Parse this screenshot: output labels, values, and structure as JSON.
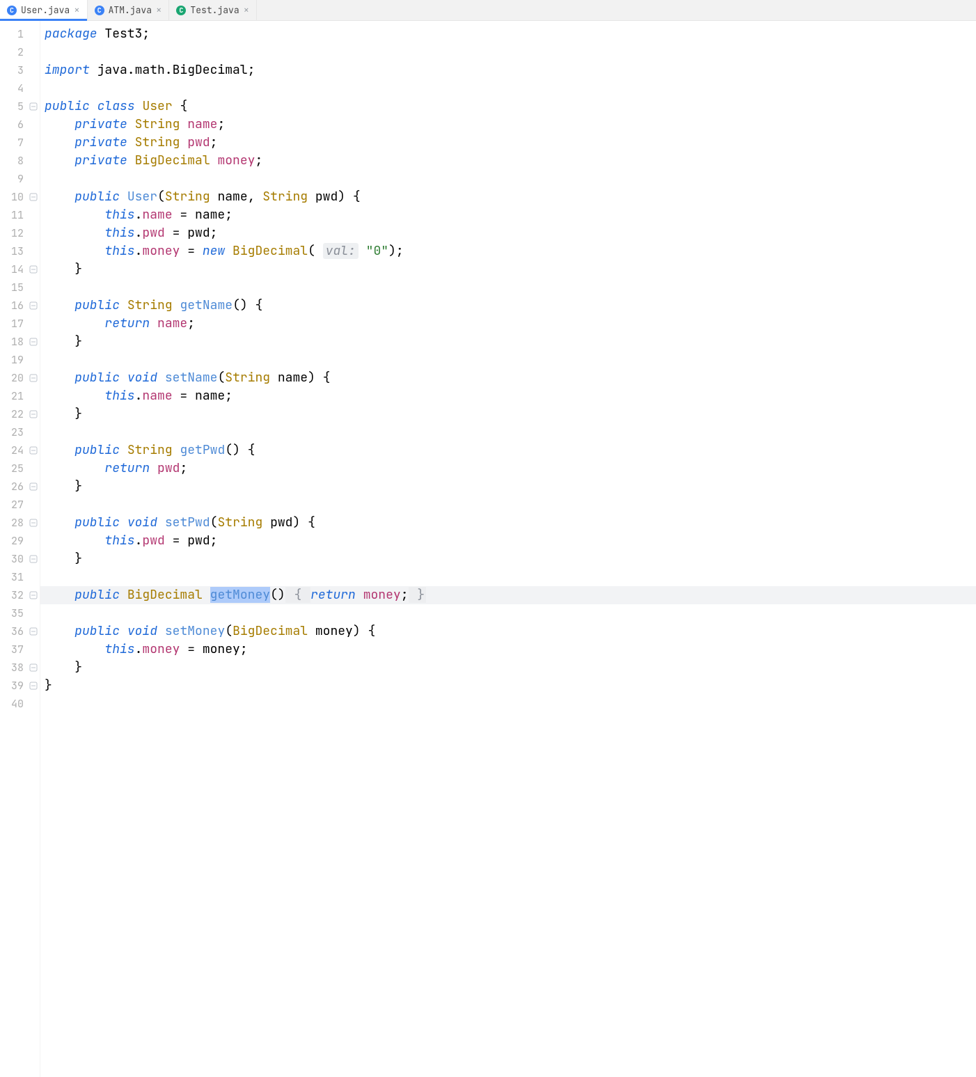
{
  "tabs": [
    {
      "label": "User.java",
      "iconLetter": "C",
      "iconClass": "c",
      "active": true
    },
    {
      "label": "ATM.java",
      "iconLetter": "C",
      "iconClass": "c",
      "active": false
    },
    {
      "label": "Test.java",
      "iconLetter": "C",
      "iconClass": "ct",
      "active": false
    }
  ],
  "lineNumbers": [
    "1",
    "2",
    "3",
    "4",
    "5",
    "6",
    "7",
    "8",
    "9",
    "10",
    "11",
    "12",
    "13",
    "14",
    "15",
    "16",
    "17",
    "18",
    "19",
    "20",
    "21",
    "22",
    "23",
    "24",
    "25",
    "26",
    "27",
    "28",
    "29",
    "30",
    "31",
    "32",
    "35",
    "36",
    "37",
    "38",
    "39",
    "40"
  ],
  "highlightedLine": "32",
  "code": {
    "l1": {
      "kw": "package",
      "rest": " Test3;"
    },
    "l3": {
      "kw": "import",
      "rest": " java.math.BigDecimal;"
    },
    "l5": {
      "kw1": "public",
      "kw2": "class",
      "type": "User",
      "brace": " {"
    },
    "l6": {
      "kw": "private",
      "type": "String",
      "field": "name",
      "semi": ";"
    },
    "l7": {
      "kw": "private",
      "type": "String",
      "field": "pwd",
      "semi": ";"
    },
    "l8": {
      "kw": "private",
      "type": "BigDecimal",
      "field": "money",
      "semi": ";"
    },
    "l10": {
      "kw": "public",
      "fn": "User",
      "p1": "(",
      "t1": "String",
      "a1": " name, ",
      "t2": "String",
      "a2": " pwd) {"
    },
    "l11": {
      "kw": "this",
      "dot": ".",
      "field": "name",
      "rest": " = name;"
    },
    "l12": {
      "kw": "this",
      "dot": ".",
      "field": "pwd",
      "rest": " = pwd;"
    },
    "l13": {
      "kw": "this",
      "dot": ".",
      "field": "money",
      "eq": " = ",
      "kw2": "new",
      "sp": " ",
      "type": "BigDecimal",
      "open": "( ",
      "hint": "val:",
      "str": " \"0\"",
      "close": ");"
    },
    "l14": {
      "brace": "}"
    },
    "l16": {
      "kw": "public",
      "type": "String",
      "fn": "getName",
      "rest": "() {"
    },
    "l17": {
      "kw": "return",
      "field": "name",
      "semi": ";"
    },
    "l18": {
      "brace": "}"
    },
    "l20": {
      "kw": "public",
      "kw2": "void",
      "fn": "setName",
      "open": "(",
      "type": "String",
      "rest": " name) {"
    },
    "l21": {
      "kw": "this",
      "dot": ".",
      "field": "name",
      "rest": " = name;"
    },
    "l22": {
      "brace": "}"
    },
    "l24": {
      "kw": "public",
      "type": "String",
      "fn": "getPwd",
      "rest": "() {"
    },
    "l25": {
      "kw": "return",
      "field": "pwd",
      "semi": ";"
    },
    "l26": {
      "brace": "}"
    },
    "l28": {
      "kw": "public",
      "kw2": "void",
      "fn": "setPwd",
      "open": "(",
      "type": "String",
      "rest": " pwd) {"
    },
    "l29": {
      "kw": "this",
      "dot": ".",
      "field": "pwd",
      "rest": " = pwd;"
    },
    "l30": {
      "brace": "}"
    },
    "l32": {
      "kw": "public",
      "type": "BigDecimal",
      "fn": "getMoney",
      "rest1": "()",
      "brace1": " { ",
      "kw2": "return",
      "field": "money",
      "semi": ";",
      "brace2": " }"
    },
    "l36": {
      "kw": "public",
      "kw2": "void",
      "fn": "setMoney",
      "open": "(",
      "type": "BigDecimal",
      "rest": " money) {"
    },
    "l37": {
      "kw": "this",
      "dot": ".",
      "field": "money",
      "rest": " = money;"
    },
    "l38": {
      "brace": "}"
    },
    "l39": {
      "brace": "}"
    }
  }
}
